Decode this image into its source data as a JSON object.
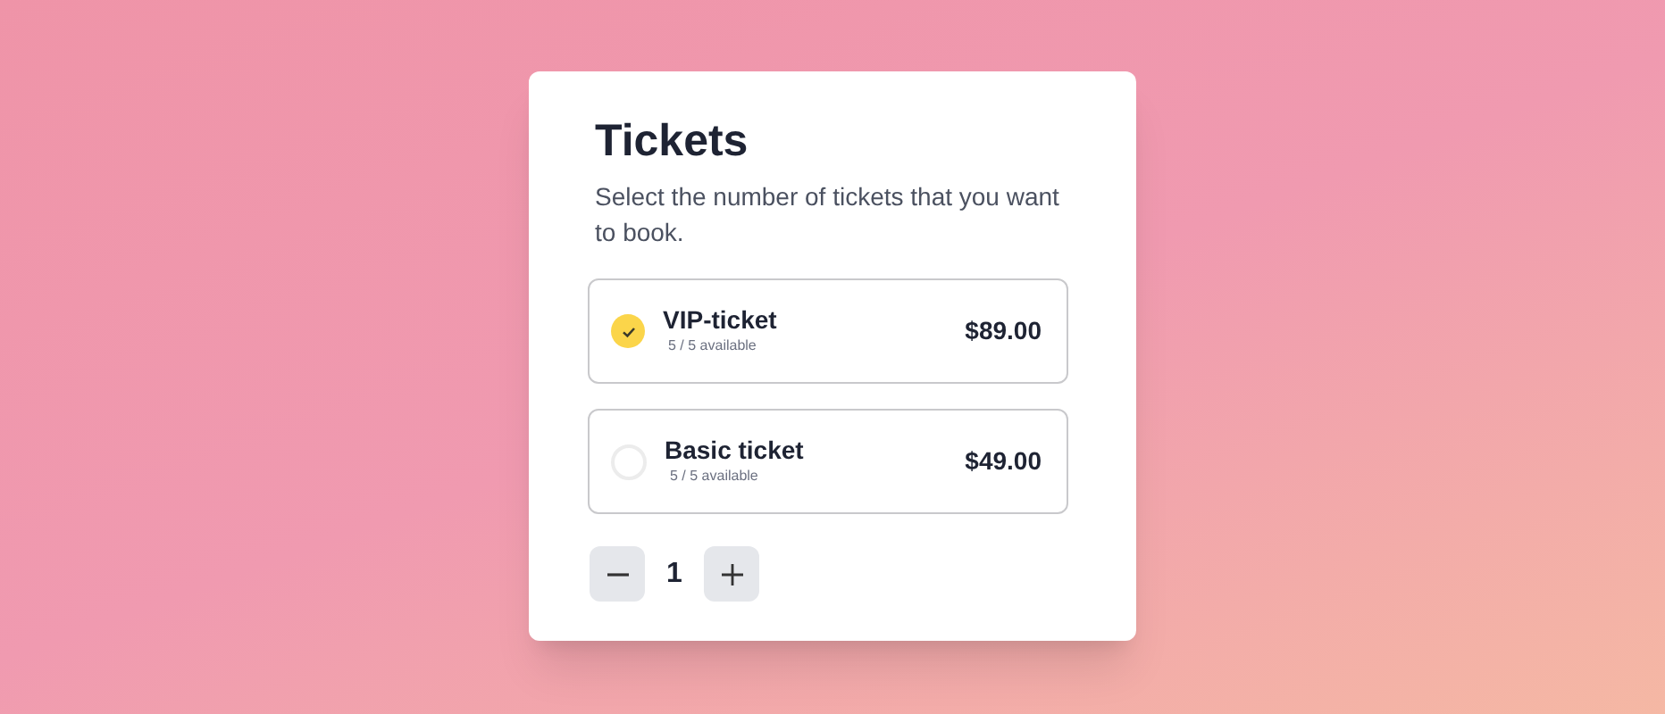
{
  "title": "Tickets",
  "description": "Select the number of tickets that you want to book.",
  "options": [
    {
      "name": "VIP-ticket",
      "availability": "5 / 5 available",
      "price": "$89.00",
      "selected": true
    },
    {
      "name": "Basic ticket",
      "availability": "5 / 5 available",
      "price": "$49.00",
      "selected": false
    }
  ],
  "quantity": "1"
}
